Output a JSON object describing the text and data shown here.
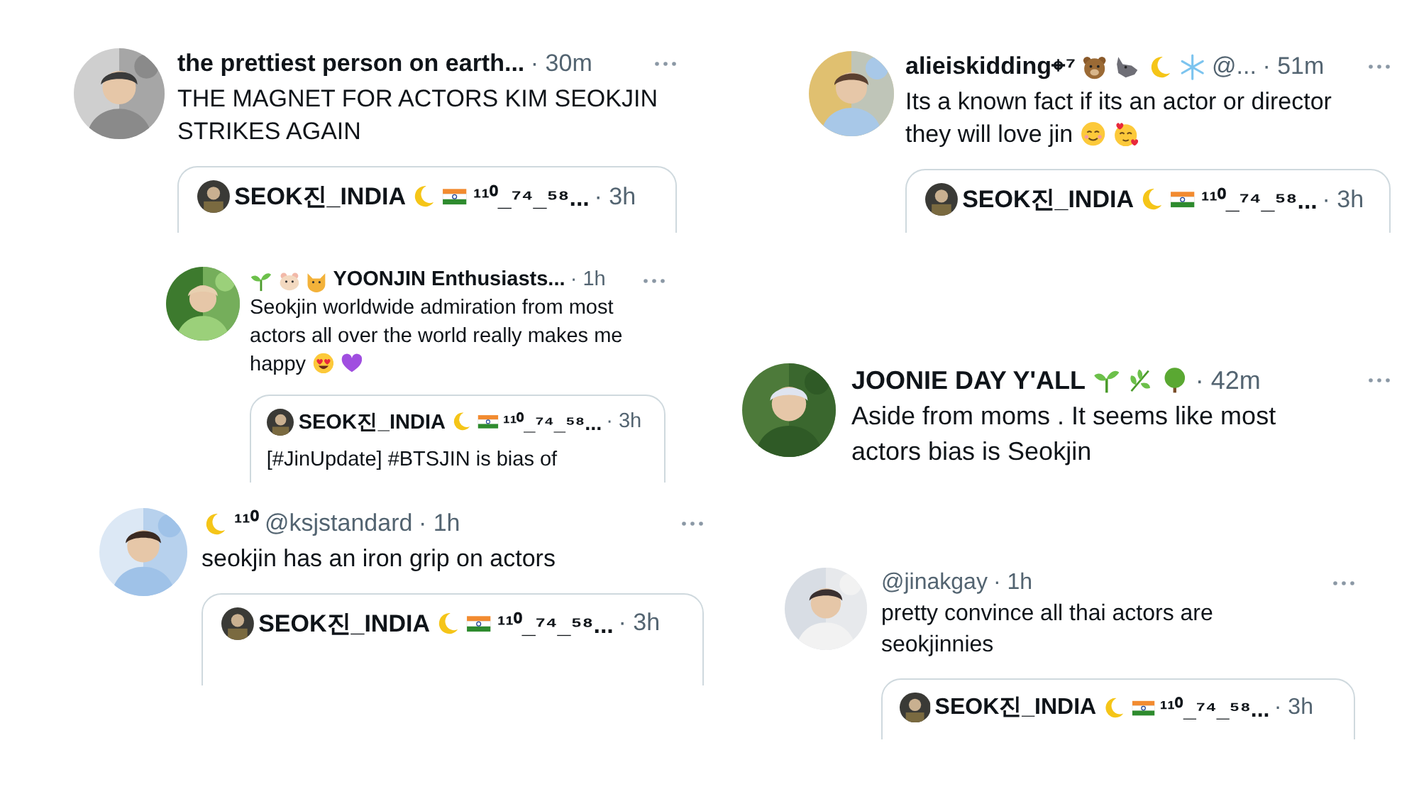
{
  "tweets": [
    {
      "avatar": {
        "kind": "picture"
      },
      "author": [
        {
          "kind": "text",
          "text": "the prettiest person on earth..."
        }
      ],
      "time": "· 30m",
      "body": [
        {
          "kind": "text",
          "text": "THE MAGNET FOR ACTORS KIM SEOKJIN STRIKES AGAIN"
        }
      ],
      "quote": {
        "author": [
          {
            "kind": "text",
            "text": "SEOK진_INDIA"
          },
          {
            "kind": "moon"
          },
          {
            "kind": "flag"
          },
          {
            "kind": "text",
            "text": "¹¹⁰_⁷⁴_⁵⁸..."
          }
        ],
        "time": "· 3h"
      }
    },
    {
      "avatar": {
        "kind": "picture"
      },
      "author": [
        {
          "kind": "text",
          "text": "alieiskidding⌖⁷"
        },
        {
          "kind": "bear"
        },
        {
          "kind": "wolf"
        },
        {
          "kind": "moon"
        },
        {
          "kind": "snowflake"
        },
        {
          "kind": "handle",
          "text": "@..."
        }
      ],
      "time": "· 51m",
      "body": [
        {
          "kind": "text",
          "text": "Its a known fact if its an actor or director"
        },
        {
          "kind": "text",
          "text": "they will love jin"
        },
        {
          "kind": "smile"
        },
        {
          "kind": "hearts"
        }
      ],
      "quote": {
        "author": [
          {
            "kind": "text",
            "text": "SEOK진_INDIA"
          },
          {
            "kind": "moon"
          },
          {
            "kind": "flag"
          },
          {
            "kind": "text",
            "text": "¹¹⁰_⁷⁴_⁵⁸..."
          }
        ],
        "time": "· 3h"
      }
    },
    {
      "avatar": {
        "kind": "picture"
      },
      "author": [
        {
          "kind": "sprout"
        },
        {
          "kind": "hamster"
        },
        {
          "kind": "cat"
        },
        {
          "kind": "text",
          "text": "YOONJIN Enthusiasts..."
        }
      ],
      "time": "· 1h",
      "body": [
        {
          "kind": "text",
          "text": "Seokjin worldwide admiration from most"
        },
        {
          "kind": "text",
          "text": "actors all over the world really makes me"
        },
        {
          "kind": "text",
          "text": "happy"
        },
        {
          "kind": "heart-eyes"
        },
        {
          "kind": "heart"
        }
      ],
      "quote": {
        "author": [
          {
            "kind": "text",
            "text": "SEOK진_INDIA"
          },
          {
            "kind": "moon"
          },
          {
            "kind": "flag"
          },
          {
            "kind": "text",
            "text": "¹¹⁰_⁷⁴_⁵⁸..."
          }
        ],
        "time": "· 3h",
        "body": "[#JinUpdate] #BTSJIN is bias of"
      }
    },
    {
      "avatar": {
        "kind": "picture"
      },
      "author": [
        {
          "kind": "text",
          "text": "JOONIE DAY Y'ALL"
        },
        {
          "kind": "sprout"
        },
        {
          "kind": "leaf"
        },
        {
          "kind": "tree"
        }
      ],
      "time": "· 42m",
      "body": [
        {
          "kind": "text",
          "text": "Aside from moms . It seems like most actors bias is Seokjin"
        }
      ]
    },
    {
      "avatar": {
        "kind": "picture"
      },
      "author": [
        {
          "kind": "moon"
        },
        {
          "kind": "text",
          "text": "¹¹⁰"
        },
        {
          "kind": "handle",
          "text": "@ksjstandard"
        }
      ],
      "time": "· 1h",
      "body": [
        {
          "kind": "text",
          "text": "seokjin has an iron grip on actors"
        }
      ],
      "quote": {
        "author": [
          {
            "kind": "text",
            "text": "SEOK진_INDIA"
          },
          {
            "kind": "moon"
          },
          {
            "kind": "flag"
          },
          {
            "kind": "text",
            "text": "¹¹⁰_⁷⁴_⁵⁸..."
          }
        ],
        "time": "· 3h"
      }
    },
    {
      "avatar": {
        "kind": "picture"
      },
      "author": [
        {
          "kind": "handle",
          "text": "@jinakgay"
        }
      ],
      "time": "· 1h",
      "body": [
        {
          "kind": "text",
          "text": "pretty convince all thai actors are seokjinnies"
        }
      ],
      "quote": {
        "author": [
          {
            "kind": "text",
            "text": "SEOK진_INDIA"
          },
          {
            "kind": "moon"
          },
          {
            "kind": "flag"
          },
          {
            "kind": "text",
            "text": "¹¹⁰_⁷⁴_⁵⁸..."
          }
        ],
        "time": "· 3h"
      }
    }
  ]
}
